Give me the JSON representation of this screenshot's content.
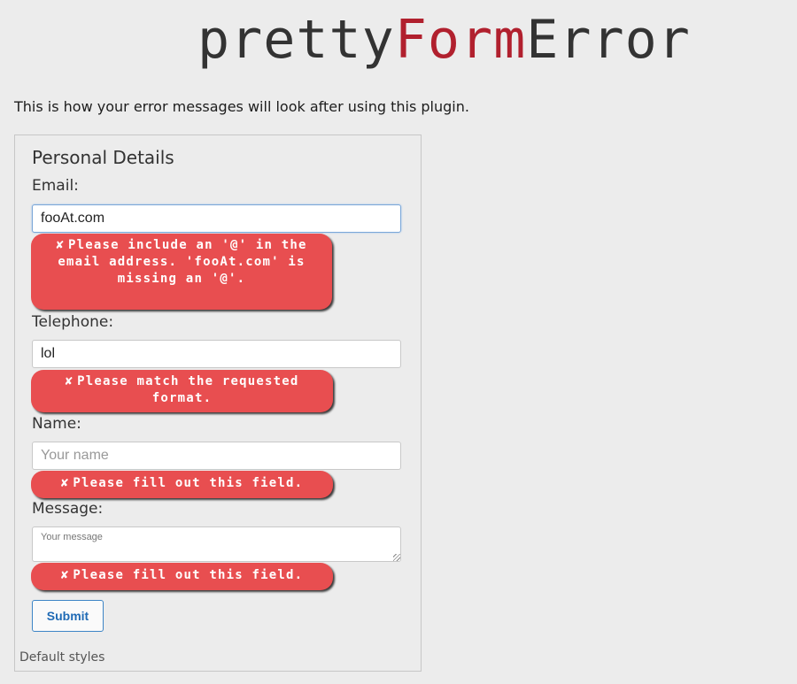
{
  "logo": {
    "part1": "pretty",
    "part2": "Form",
    "part3": "Error"
  },
  "intro": "This is how your error messages will look after using this plugin.",
  "form": {
    "legend": "Personal Details",
    "email": {
      "label": "Email:",
      "value": "fooAt.com",
      "error_icon": "✘",
      "error": "Please include an '@' in the email address. 'fooAt.com' is missing an '@'."
    },
    "telephone": {
      "label": "Telephone:",
      "value": "lol",
      "error_icon": "✘",
      "error": "Please match the requested format."
    },
    "name": {
      "label": "Name:",
      "value": "",
      "placeholder": "Your name",
      "error_icon": "✘",
      "error": "Please fill out this field."
    },
    "message": {
      "label": "Message:",
      "value": "",
      "placeholder": "Your message",
      "error_icon": "✘",
      "error": "Please fill out this field."
    },
    "submit_label": "Submit",
    "caption": "Default styles"
  },
  "colors": {
    "background": "#ececec",
    "error_bubble": "#e84e50",
    "logo_accent": "#b1202e",
    "submit_border": "#3d85c6"
  }
}
